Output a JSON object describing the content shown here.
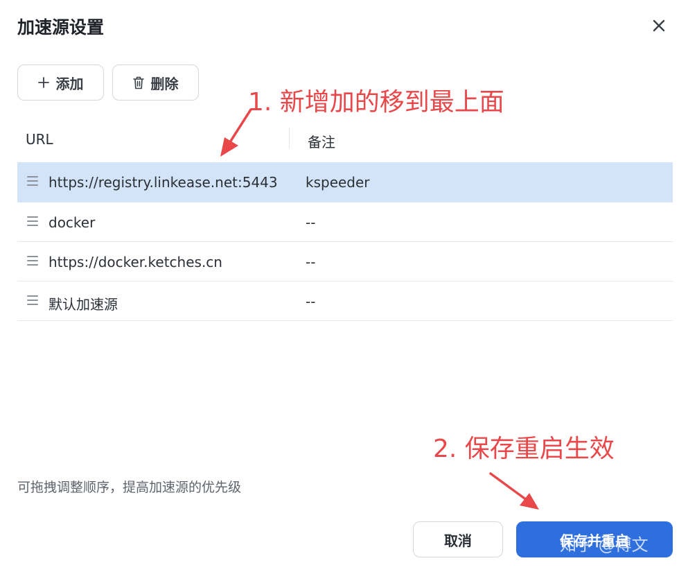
{
  "dialog": {
    "title": "加速源设置",
    "close_icon": "close-icon"
  },
  "toolbar": {
    "add_label": "添加",
    "add_icon": "plus-icon",
    "delete_label": "删除",
    "delete_icon": "trash-icon"
  },
  "table": {
    "headers": {
      "url": "URL",
      "note": "备注"
    },
    "rows": [
      {
        "url": "https://registry.linkease.net:5443",
        "note": "kspeeder",
        "selected": true
      },
      {
        "url": "docker",
        "note": "--",
        "selected": false
      },
      {
        "url": "https://docker.ketches.cn",
        "note": "--",
        "selected": false
      },
      {
        "url": "默认加速源",
        "note": "--",
        "selected": false
      }
    ]
  },
  "hint": "可拖拽调整顺序，提高加速源的优先级",
  "footer": {
    "cancel_label": "取消",
    "save_label": "保存并重启"
  },
  "annotations": {
    "step1": "1. 新增加的移到最上面",
    "step2": "2. 保存重启生效",
    "color": "#e8484a"
  },
  "watermark": "知乎 @博文",
  "colors": {
    "primary": "#2f6fdd",
    "selected_row": "#d3e4f8"
  }
}
